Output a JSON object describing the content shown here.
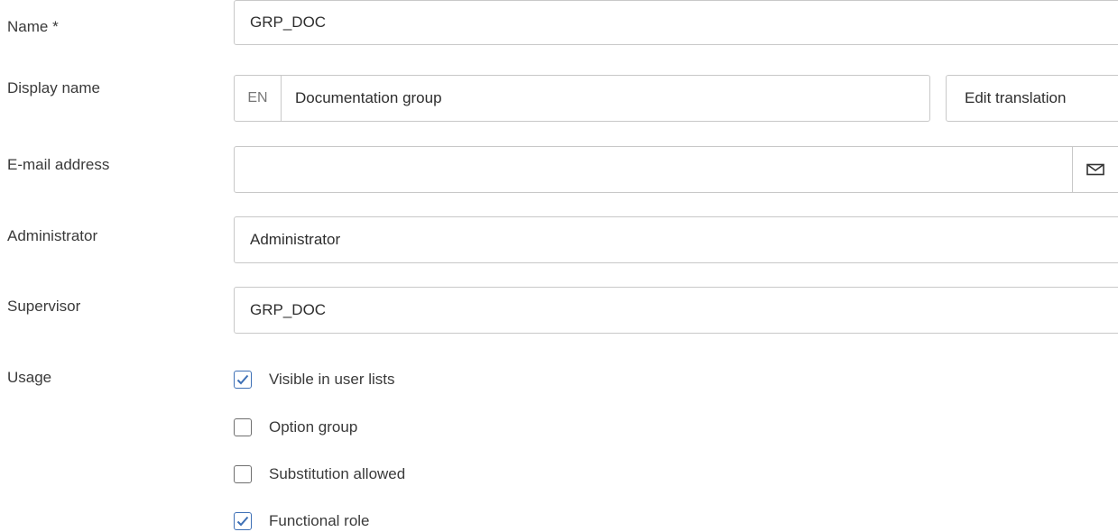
{
  "form": {
    "name": {
      "label": "Name *",
      "value": "GRP_DOC"
    },
    "display_name": {
      "label": "Display name",
      "language": "EN",
      "value": "Documentation group",
      "edit_button": "Edit translation"
    },
    "email": {
      "label": "E-mail address",
      "value": "",
      "button_icon": "envelope-icon"
    },
    "administrator": {
      "label": "Administrator",
      "value": "Administrator"
    },
    "supervisor": {
      "label": "Supervisor",
      "value": "GRP_DOC"
    },
    "usage": {
      "label": "Usage",
      "options": [
        {
          "label": "Visible in user lists",
          "checked": true
        },
        {
          "label": "Option group",
          "checked": false
        },
        {
          "label": "Substitution allowed",
          "checked": false
        },
        {
          "label": "Functional role",
          "checked": true
        }
      ]
    }
  },
  "colors": {
    "border": "#c8c8c8",
    "check_accent": "#3d6fb5"
  }
}
